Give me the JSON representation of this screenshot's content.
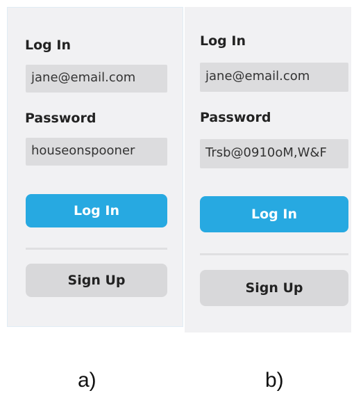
{
  "panel_a": {
    "login_heading": "Log In",
    "email_value": "jane@email.com",
    "password_heading": "Password",
    "password_value": "houseonspooner",
    "login_button": "Log In",
    "signup_button": "Sign Up"
  },
  "panel_b": {
    "login_heading": "Log In",
    "email_value": "jane@email.com",
    "password_heading": "Password",
    "password_value": "Trsb@0910oM,W&F",
    "login_button": "Log In",
    "signup_button": "Sign Up"
  },
  "captions": {
    "a": "a)",
    "b": "b)"
  },
  "colors": {
    "primary_button": "#27a9e1",
    "secondary_button": "#d8d8da",
    "panel_background": "#f1f1f3",
    "field_background": "#dcdcde"
  }
}
